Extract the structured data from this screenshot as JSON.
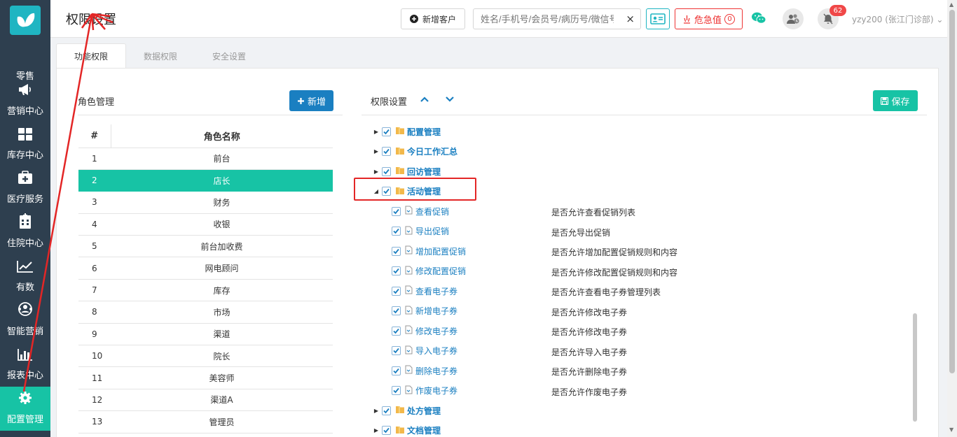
{
  "sidebar": {
    "items": [
      {
        "label": "零售",
        "icon": "cart-icon"
      },
      {
        "label": "营销中心",
        "icon": "megaphone-icon"
      },
      {
        "label": "库存中心",
        "icon": "grid-icon"
      },
      {
        "label": "医疗服务",
        "icon": "medical-kit-icon"
      },
      {
        "label": "住院中心",
        "icon": "hospital-icon"
      },
      {
        "label": "有数",
        "icon": "trend-chart-icon"
      },
      {
        "label": "智能营销",
        "icon": "smart-marketing-icon"
      },
      {
        "label": "报表中心",
        "icon": "bar-chart-icon"
      },
      {
        "label": "配置管理",
        "icon": "gear-icon",
        "active": true
      }
    ]
  },
  "header": {
    "title": "权限设置",
    "new_customer_label": "新增客户",
    "search_placeholder": "姓名/手机号/会员号/病历号/微信号",
    "search_clear": "×",
    "danger_label": "危急值",
    "danger_count": "0",
    "notification_count": "62",
    "user_label": "yzy200 (张江门诊部)"
  },
  "tabs": [
    {
      "label": "功能权限",
      "active": true
    },
    {
      "label": "数据权限",
      "active": false
    },
    {
      "label": "安全设置",
      "active": false
    }
  ],
  "roles": {
    "title": "角色管理",
    "add_label": "新增",
    "col_num": "#",
    "col_name": "角色名称",
    "rows": [
      {
        "num": "1",
        "name": "前台"
      },
      {
        "num": "2",
        "name": "店长",
        "selected": true
      },
      {
        "num": "3",
        "name": "财务"
      },
      {
        "num": "4",
        "name": "收银"
      },
      {
        "num": "5",
        "name": "前台加收费"
      },
      {
        "num": "6",
        "name": "网电顾问"
      },
      {
        "num": "7",
        "name": "库存"
      },
      {
        "num": "8",
        "name": "市场"
      },
      {
        "num": "9",
        "name": "渠道"
      },
      {
        "num": "10",
        "name": "院长"
      },
      {
        "num": "11",
        "name": "美容师"
      },
      {
        "num": "12",
        "name": "渠道A"
      },
      {
        "num": "13",
        "name": "管理员"
      }
    ]
  },
  "permissions": {
    "title": "权限设置",
    "save_label": "保存",
    "groups_before": [
      "配置管理",
      "今日工作汇总",
      "回访管理"
    ],
    "expanded_group": "活动管理",
    "items": [
      {
        "name": "查看促销",
        "desc": "是否允许查看促销列表"
      },
      {
        "name": "导出促销",
        "desc": "是否允导出促销"
      },
      {
        "name": "增加配置促销",
        "desc": "是否允许增加配置促销规则和内容"
      },
      {
        "name": "修改配置促销",
        "desc": "是否允许修改配置促销规则和内容"
      },
      {
        "name": "查看电子券",
        "desc": "是否允许查看电子券管理列表"
      },
      {
        "name": "新增电子券",
        "desc": "是否允许修改电子券"
      },
      {
        "name": "修改电子券",
        "desc": "是否允许修改电子券"
      },
      {
        "name": "导入电子券",
        "desc": "是否允许导入电子券"
      },
      {
        "name": "删除电子券",
        "desc": "是否允许删除电子券"
      },
      {
        "name": "作废电子券",
        "desc": "是否允许作废电子券"
      }
    ],
    "groups_after": [
      "处方管理",
      "文档管理"
    ]
  },
  "colors": {
    "sidebar_bg": "#2e3f4f",
    "accent_teal": "#17c3a5",
    "accent_blue": "#1a7fc1",
    "danger_red": "#e33333"
  }
}
